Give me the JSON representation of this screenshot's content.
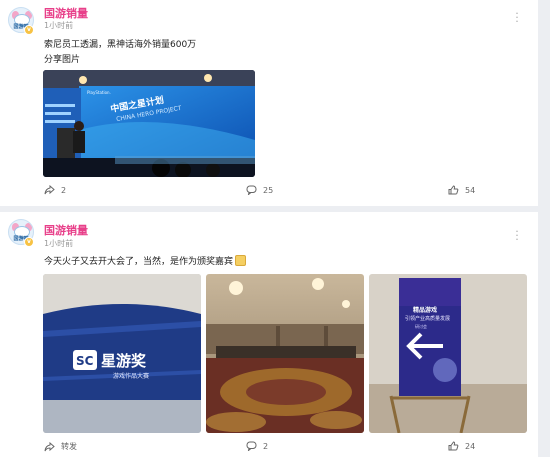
{
  "posts": [
    {
      "author": "国游销量",
      "avatar_text": "国游吧",
      "time": "1小时前",
      "lines": [
        "索尼员工透漏，黑神话海外销量600万",
        "分享图片"
      ],
      "images": [
        {
          "screen_text": "中国之星计划",
          "screen_subtext": "CHINA HERO PROJECT",
          "brand": "PlayStation."
        }
      ],
      "share_count": "2",
      "comment_count": "25",
      "like_count": "54"
    },
    {
      "author": "国游销量",
      "avatar_text": "国游吧",
      "time": "1小时前",
      "lines": [
        "今天火子又去开大会了，当然，是作为颁奖嘉宾"
      ],
      "images": [
        {
          "logo_text": "SC",
          "title": "星游奖",
          "subtitle": "游戏作品大赛"
        },
        {},
        {
          "poster_title": "精品游戏",
          "poster_subtitle": "引领产业高质量发展",
          "poster_note": "研讨会"
        }
      ],
      "share_label": "转发",
      "comment_count": "2",
      "like_count": "24"
    }
  ],
  "icons": {
    "share": "share-icon",
    "comment": "comment-icon",
    "like": "thumbs-up-icon",
    "more": "more-vertical-icon"
  }
}
